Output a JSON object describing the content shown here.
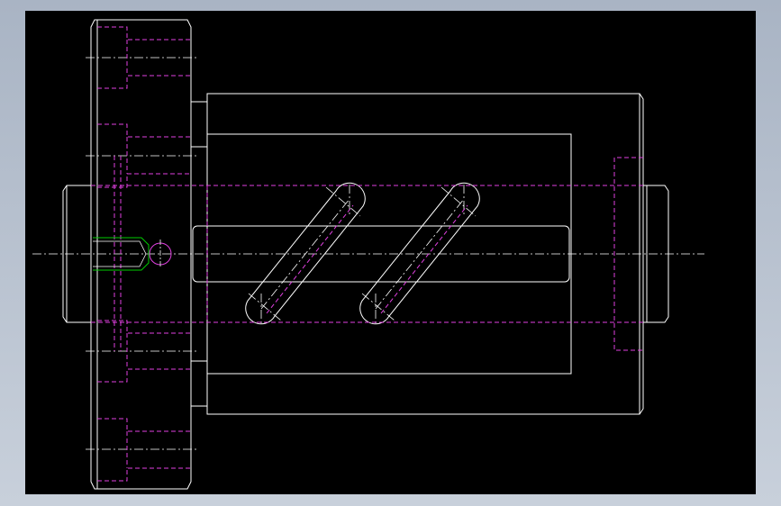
{
  "viewport": {
    "background": "#000000",
    "line_colors": {
      "visible_edge": "#ffffff",
      "hidden_edge": "#e040e0",
      "thread_highlight": "#00cc00",
      "center_line": "#ffffff"
    }
  }
}
